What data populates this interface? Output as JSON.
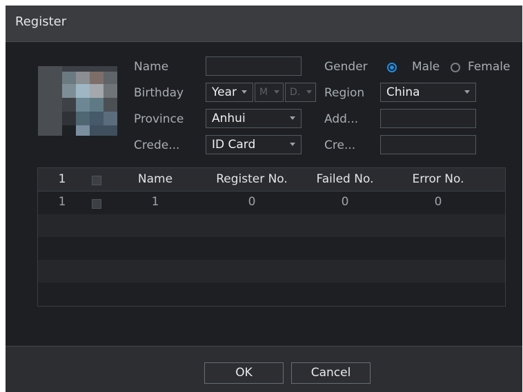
{
  "dialog": {
    "title": "Register"
  },
  "form": {
    "name_label": "Name",
    "name_value": "",
    "birthday_label": "Birthday",
    "birthday_year": "Year",
    "birthday_month": "M",
    "birthday_day": "D.",
    "province_label": "Province",
    "province_value": "Anhui",
    "credential_label": "Crede...",
    "credential_value": "ID Card",
    "gender_label": "Gender",
    "gender_male": "Male",
    "gender_female": "Female",
    "gender_selected": "Male",
    "region_label": "Region",
    "region_value": "China",
    "address_label": "Add...",
    "address_value": "",
    "credential_no_label": "Cre...",
    "credential_no_value": ""
  },
  "table": {
    "header": {
      "index": "1",
      "name": "Name",
      "register_no": "Register No.",
      "failed_no": "Failed No.",
      "error_no": "Error No."
    },
    "rows": [
      {
        "index": "1",
        "name": "1",
        "register_no": "0",
        "failed_no": "0",
        "error_no": "0"
      }
    ]
  },
  "footer": {
    "ok_label": "OK",
    "cancel_label": "Cancel"
  },
  "colors": {
    "accent": "#1f8fe5",
    "background": "#1d1f22",
    "titlebar": "#3a3c40"
  }
}
